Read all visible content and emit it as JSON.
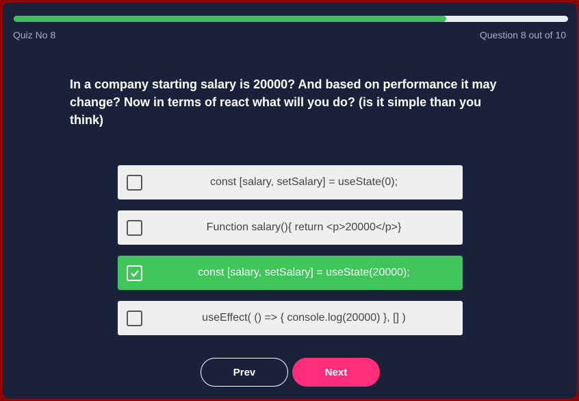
{
  "quiz_label": "Quiz No 8",
  "progress_text": "Question 8 out of 10",
  "progress_fraction": 0.78,
  "question": "In a company starting salary is 20000? And based on performance it may change? Now in terms of react what will you do? (is it simple than you think)",
  "options": [
    {
      "label": "const [salary, setSalary] = useState(0);",
      "checked": false
    },
    {
      "label": "Function salary(){ return <p>20000</p>}",
      "checked": false
    },
    {
      "label": "const [salary, setSalary] = useState(20000);",
      "checked": true
    },
    {
      "label": "useEffect( () => { console.log(20000) }, [] )",
      "checked": false
    }
  ],
  "prev_label": "Prev",
  "next_label": "Next",
  "colors": {
    "accent": "#3fc55a",
    "next": "#ff2e7a",
    "bg": "#1a223b"
  }
}
